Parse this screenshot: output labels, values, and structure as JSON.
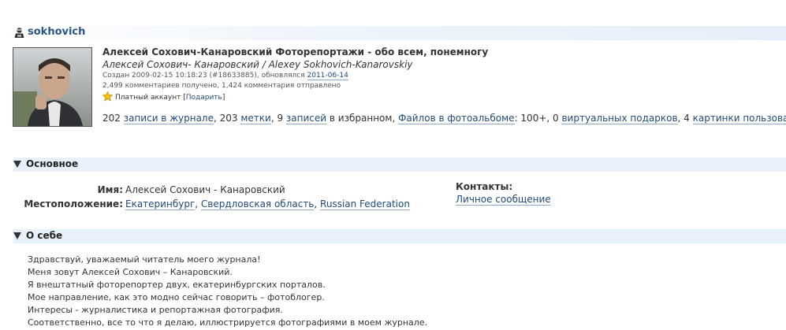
{
  "user": {
    "username": "sokhovich"
  },
  "profile": {
    "title": "Алексей Сохович-Канаровский Фоторепортажи - обо всем, понемногу",
    "subtitle": "Алексей Сохович- Канаровский / Alexey Sokhovich-Kanarovskiy",
    "created_prefix": "Создан 2009-02-15 10:18:23 (#18633885), обновлялся ",
    "updated_date": "2011-06-14",
    "comments_line": "2,499 комментариев получено, 1,424 комментария отправлено",
    "paid_label": "Платный аккаунт",
    "gift_link": "Подарить",
    "gift_brackets": {
      "open": "[",
      "close": "]"
    },
    "stats": [
      {
        "num": "202 ",
        "link": "записи в журнале",
        "sep": ", "
      },
      {
        "num": "203 ",
        "link": "метки",
        "sep": ", "
      },
      {
        "num": "9 ",
        "link": "записей",
        "after": " в избранном",
        "sep": ", "
      },
      {
        "num": "",
        "link": "Файлов в фотоальбоме",
        "after": ": 100+",
        "sep": ", "
      },
      {
        "num": "0 ",
        "link": "виртуальных подарков",
        "sep": ", "
      },
      {
        "num": "4 ",
        "link": "картинки пользователя",
        "sep": ""
      }
    ]
  },
  "sections": {
    "basic": {
      "label": "Основное"
    },
    "about": {
      "label": "О себе"
    }
  },
  "basic": {
    "name_label": "Имя:",
    "name_value": "Алексей Сохович - Канаровский",
    "location_label": "Местоположение:",
    "location_city": "Екатеринбург",
    "location_region": "Свердловская область",
    "location_country": "Russian Federation",
    "location_sep": ", ",
    "contacts_label": "Контакты:",
    "contacts_link": "Личное сообщение"
  },
  "about_lines": [
    "Здравствуй, уважаемый читатель моего журнала!",
    "Меня зовут Алексей Сохович – Канаровский.",
    "Я внештатный фоторепортер двух, екатеринбургских порталов.",
    "Мое направление, как это модно сейчас говорить – фотоблогер.",
    "Интересы - журналистика и репортажная фотография.",
    "Соответственно, все то что я делаю, иллюстрируется фотографиями в моем журнале."
  ],
  "colors": {
    "link": "#1f4b7a",
    "section_bg": "#e8f1fa",
    "username": "#2a5587"
  }
}
